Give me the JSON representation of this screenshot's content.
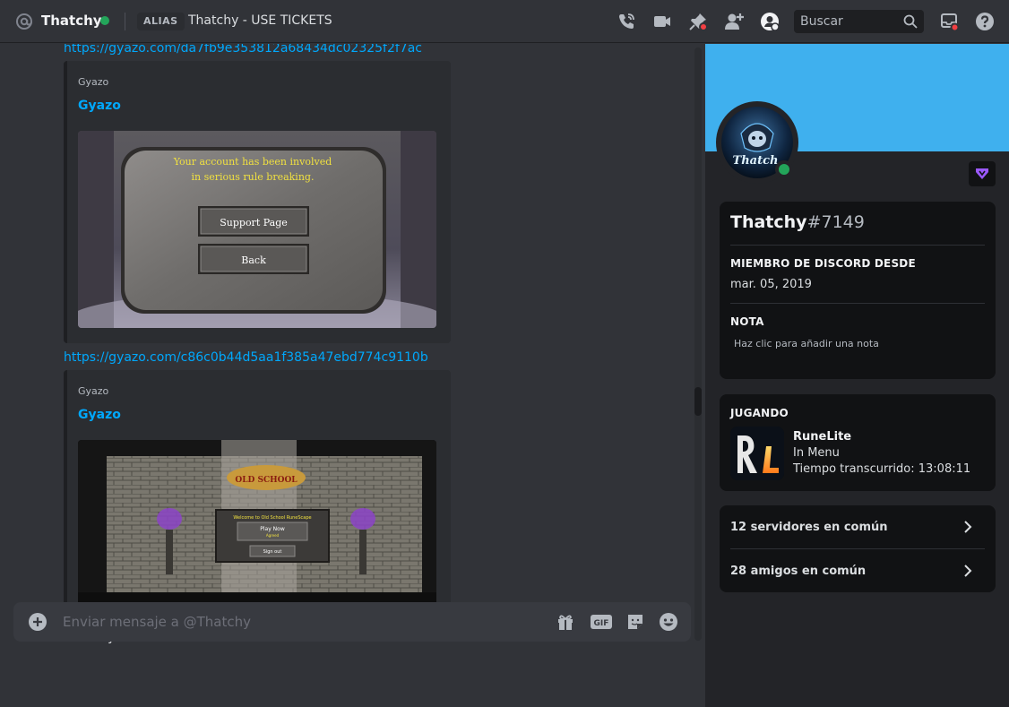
{
  "header": {
    "user": "Thatchy",
    "alias_tag": "ALIAS",
    "alias_text": "Thatchy - USE TICKETS",
    "search_placeholder": "Buscar",
    "icons": [
      "at-icon",
      "call-icon",
      "video-icon",
      "pin-icon",
      "add-friend-icon",
      "profile-icon",
      "search-icon",
      "inbox-icon",
      "help-icon"
    ]
  },
  "chat": {
    "link1": "https://gyazo.com/da7fb9e353812a68434dc02325f2f7ac",
    "link2": "https://gyazo.com/c86c0b44d5aa1f385a47ebd774c9110b",
    "embed1": {
      "provider": "Gyazo",
      "title": "Gyazo",
      "img_line1": "Your account has been involved",
      "img_line2": "in serious rule breaking.",
      "img_btn1": "Support Page",
      "img_btn2": "Back"
    },
    "embed2": {
      "provider": "Gyazo",
      "title": "Gyazo",
      "img_logo": "OLD SCHOOL",
      "img_welcome": "Welcome to Old School RuneScape",
      "img_play": "Play Now",
      "img_play_sub": "Agreed",
      "img_signout": "Sign out"
    },
    "message": "im sorry bro"
  },
  "composer": {
    "placeholder": "Enviar mensaje a @Thatchy",
    "gif_label": "GIF"
  },
  "profile": {
    "avatar_text": "Thatch",
    "username": "Thatchy",
    "discriminator": "#7149",
    "member_since_label": "MIEMBRO DE DISCORD DESDE",
    "member_since": "mar. 05, 2019",
    "note_label": "NOTA",
    "note_placeholder": "Haz clic para añadir una nota",
    "playing_label": "JUGANDO",
    "game_name": "RuneLite",
    "game_state": "In Menu",
    "game_time": "Tiempo transcurrido: 13:08:11",
    "game_icon_text": "RL",
    "mutual_servers": "12 servidores en común",
    "mutual_friends": "28 amigos en común"
  },
  "colors": {
    "accent_link": "#00a8fc",
    "online": "#23a55a",
    "banner": "#3fb0ee",
    "nitro_badge": "#9b59ff"
  }
}
